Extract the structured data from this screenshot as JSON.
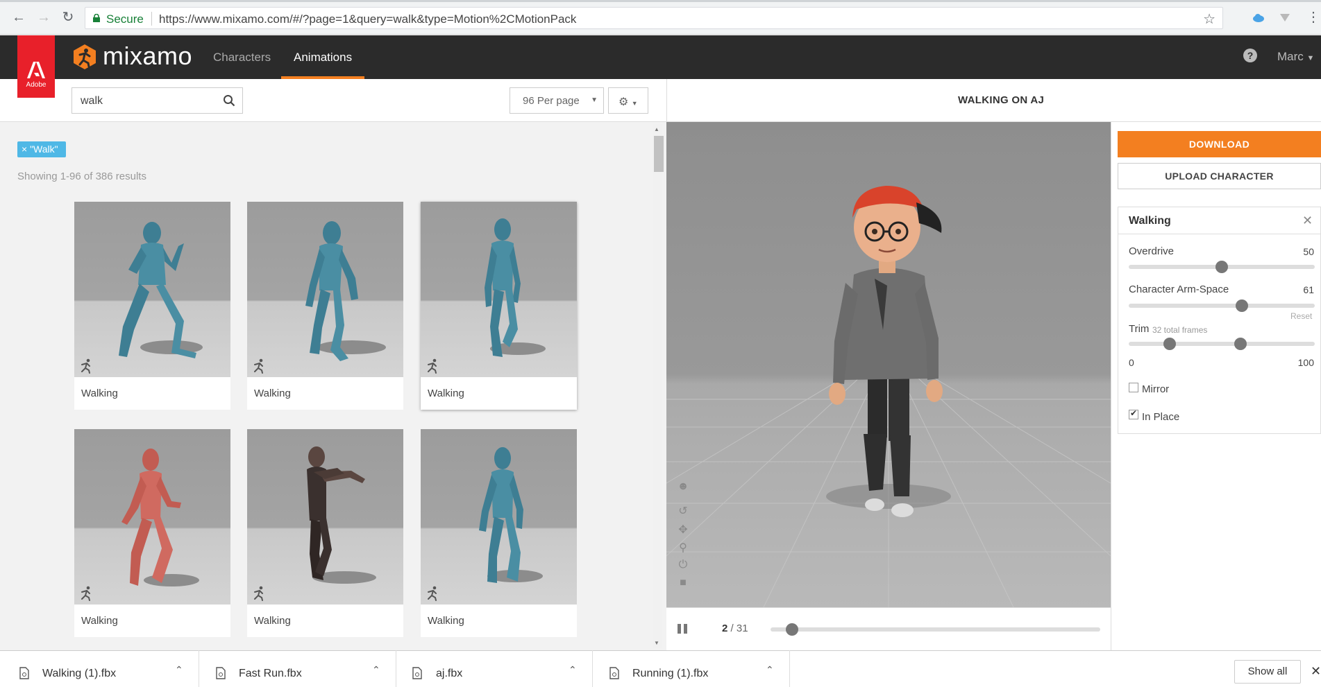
{
  "browser": {
    "secure_label": "Secure",
    "url": "https://www.mixamo.com/#/?page=1&query=walk&type=Motion%2CMotionPack"
  },
  "header": {
    "adobe_label": "Adobe",
    "logo_text": "mixamo",
    "tabs": [
      {
        "label": "Characters",
        "active": false
      },
      {
        "label": "Animations",
        "active": true
      }
    ],
    "help_icon": "?",
    "user_name": "Marc"
  },
  "toolbar": {
    "search_value": "walk",
    "per_page": "96 Per page",
    "settings_icon": "gear-icon"
  },
  "results": {
    "filter_chip": "× \"Walk\"",
    "count_text": "Showing 1-96 of 386 results",
    "cards": [
      {
        "label": "Walking",
        "figure": "blue"
      },
      {
        "label": "Walking",
        "figure": "blue"
      },
      {
        "label": "Walking",
        "figure": "blue",
        "selected": true
      },
      {
        "label": "Walking",
        "figure": "red"
      },
      {
        "label": "Walking",
        "figure": "zombie"
      },
      {
        "label": "Walking",
        "figure": "blue"
      }
    ]
  },
  "viewer": {
    "title": "WALKING ON AJ",
    "frame_current": "2",
    "frame_total": "31",
    "playhead_fraction": 0.0645
  },
  "panel": {
    "download_label": "DOWNLOAD",
    "upload_label": "UPLOAD CHARACTER",
    "settings_title": "Walking",
    "overdrive": {
      "label": "Overdrive",
      "value": "50",
      "fraction": 0.5
    },
    "arm_space": {
      "label": "Character Arm-Space",
      "value": "61",
      "fraction": 0.61
    },
    "reset_label": "Reset",
    "trim": {
      "label": "Trim",
      "sub": "32 total frames",
      "min": "0",
      "max": "100",
      "start_fraction": 0.22,
      "end_fraction": 0.6
    },
    "mirror": {
      "label": "Mirror",
      "checked": false
    },
    "in_place": {
      "label": "In Place",
      "checked": true
    }
  },
  "downloads": {
    "items": [
      "Walking (1).fbx",
      "Fast Run.fbx",
      "aj.fbx",
      "Running (1).fbx"
    ],
    "show_all": "Show all"
  },
  "colors": {
    "accent": "#f37f20",
    "chip": "#4fb8e6",
    "adobe_red": "#e8202a",
    "header_bg": "#2b2b2b"
  }
}
